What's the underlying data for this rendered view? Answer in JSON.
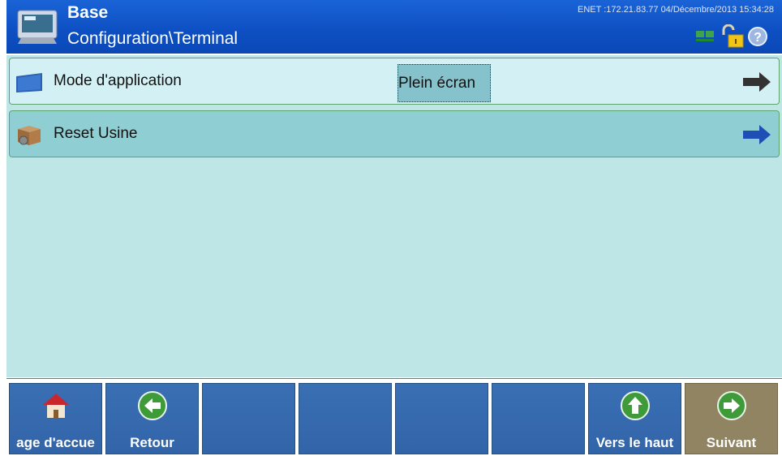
{
  "header": {
    "title": "Base",
    "subtitle": "Configuration\\Terminal",
    "status": "ENET :172.21.83.77  04/Décembre/2013 15:34:28"
  },
  "rows": [
    {
      "label": "Mode d'application",
      "value": "Plein écran",
      "icon": "monitor-icon",
      "arrow": "arrow-right-icon"
    },
    {
      "label": "Reset Usine",
      "icon": "factory-reset-box-icon",
      "arrow": "arrow-right-icon"
    }
  ],
  "softkeys": [
    {
      "label": "age d'accue",
      "icon": "home-icon"
    },
    {
      "label": "Retour",
      "icon": "back-icon"
    },
    {
      "label": ""
    },
    {
      "label": ""
    },
    {
      "label": ""
    },
    {
      "label": ""
    },
    {
      "label": "Vers le haut",
      "icon": "up-icon"
    },
    {
      "label": "Suivant",
      "icon": "next-icon"
    }
  ],
  "colors": {
    "header": "#0d4fc2",
    "content_bg": "#bfe6e6",
    "row_selected": "#d3f1f4",
    "row_highlight": "#8fcfd4",
    "softkey": "#3264a8",
    "softkey_next": "#918462"
  }
}
